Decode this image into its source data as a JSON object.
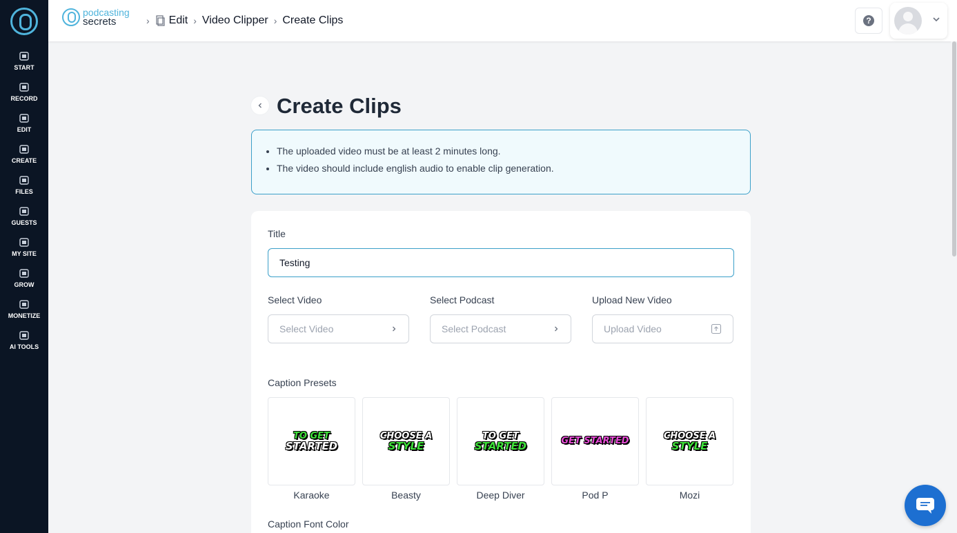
{
  "sidebar": {
    "items": [
      {
        "label": "START",
        "icon": "start-icon"
      },
      {
        "label": "RECORD",
        "icon": "microphone-icon"
      },
      {
        "label": "EDIT",
        "icon": "edit-icon"
      },
      {
        "label": "CREATE",
        "icon": "create-icon"
      },
      {
        "label": "FILES",
        "icon": "files-icon"
      },
      {
        "label": "GUESTS",
        "icon": "guests-icon"
      },
      {
        "label": "MY SITE",
        "icon": "my-site-icon"
      },
      {
        "label": "GROW",
        "icon": "grow-icon"
      },
      {
        "label": "MONETIZE",
        "icon": "monetize-icon"
      },
      {
        "label": "AI TOOLS",
        "icon": "ai-tools-icon"
      }
    ]
  },
  "header": {
    "brand_line1": "podcasting",
    "brand_line2": "secrets",
    "breadcrumbs": [
      "Edit",
      "Video Clipper",
      "Create Clips"
    ],
    "help_icon": "question-icon"
  },
  "page": {
    "title": "Create Clips",
    "info": [
      "The uploaded video must be at least 2 minutes long.",
      "The video should include english audio to enable clip generation."
    ]
  },
  "form": {
    "title_label": "Title",
    "title_value": "Testing",
    "select_video_label": "Select Video",
    "select_video_placeholder": "Select Video",
    "select_podcast_label": "Select Podcast",
    "select_podcast_placeholder": "Select Podcast",
    "upload_label": "Upload New Video",
    "upload_placeholder": "Upload Video",
    "caption_presets_label": "Caption Presets",
    "caption_font_color_label": "Caption Font Color"
  },
  "presets": [
    {
      "name": "Karaoke",
      "art_line1": "TO GET",
      "art_line2": "STARTED",
      "color1": "#3fe03a",
      "color2": "#ffffff"
    },
    {
      "name": "Beasty",
      "art_line1": "CHOOSE A",
      "art_line2": "STYLE",
      "color1": "#ffffff",
      "color2": "#3fe03a"
    },
    {
      "name": "Deep Diver",
      "art_line1": "to get",
      "art_line2": "Started",
      "color1": "#ffffff",
      "color2": "#3fe03a"
    },
    {
      "name": "Pod P",
      "art_line1": "GET STARTED",
      "art_line2": "",
      "color1": "#e64bd6",
      "color2": "#e64bd6"
    },
    {
      "name": "Mozi",
      "art_line1": "CHOOSE A",
      "art_line2": "STYLE",
      "color1": "#ffffff",
      "color2": "#3fe03a"
    }
  ],
  "colors": {
    "accent": "#3a9fc9",
    "sidebar_bg": "#0b1524",
    "chat_button": "#1d6fd1"
  }
}
